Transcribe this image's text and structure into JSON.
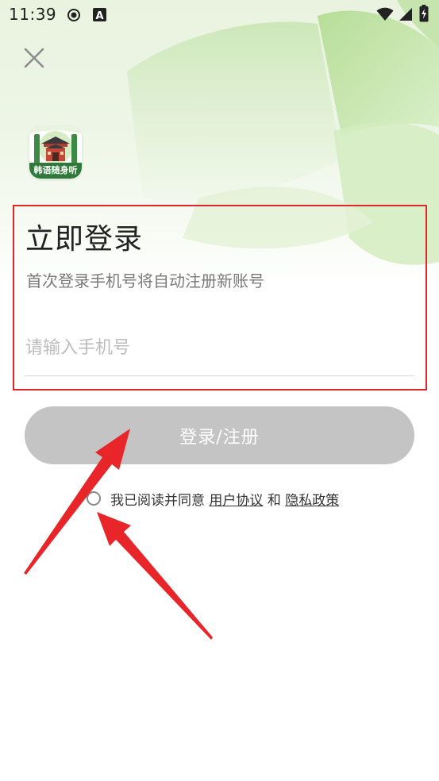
{
  "status_bar": {
    "time": "11:39",
    "left_icons": [
      "record-icon",
      "font-a-icon"
    ],
    "right_icons": [
      "wifi-icon",
      "signal-icon",
      "battery-charging-icon"
    ]
  },
  "header": {
    "close_icon": "close-icon"
  },
  "app": {
    "name": "韩语随身听",
    "logo_icon": "palace-gate-icon",
    "logo_color": "#2f7a3a"
  },
  "login": {
    "title": "立即登录",
    "subtitle": "首次登录手机号将自动注册新账号",
    "phone_placeholder": "请输入手机号",
    "phone_value": "",
    "button_label": "登录/注册",
    "button_color": "#c4c4c4"
  },
  "agreement": {
    "checked": false,
    "prefix": "我已阅读并同意",
    "user_agreement": "用户协议",
    "conjunction": "和",
    "privacy_policy": "隐私政策"
  },
  "annotations": {
    "highlight_color": "#e0262a",
    "arrow_color": "#e8262a"
  }
}
